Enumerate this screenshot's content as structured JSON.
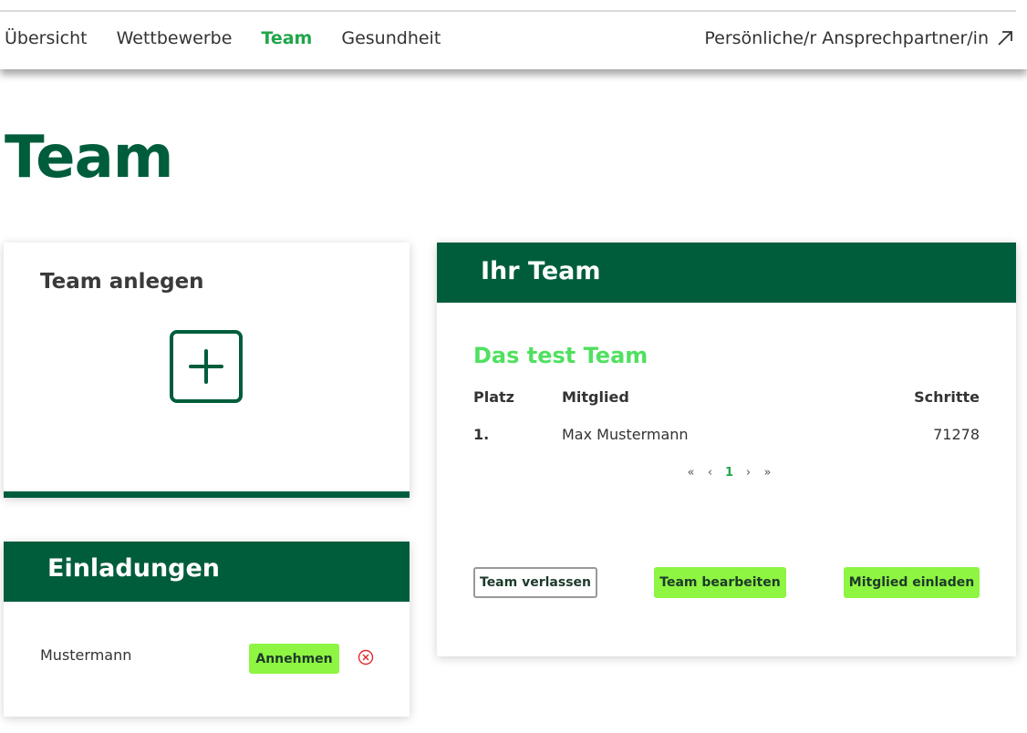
{
  "nav": {
    "items": [
      {
        "label": "Übersicht",
        "active": false
      },
      {
        "label": "Wettbewerbe",
        "active": false
      },
      {
        "label": "Team",
        "active": true
      },
      {
        "label": "Gesundheit",
        "active": false
      }
    ],
    "contact_label": "Persönliche/r Ansprechpartner/in",
    "contact_icon": "arrow-up-right-icon"
  },
  "page": {
    "title": "Team"
  },
  "create_team": {
    "title": "Team anlegen",
    "icon": "plus-square-icon"
  },
  "invitations": {
    "title": "Einladungen",
    "items": [
      {
        "name": "Mustermann",
        "accept_label": "Annehmen",
        "reject_icon": "close-circle-icon"
      }
    ]
  },
  "your_team": {
    "title": "Ihr Team",
    "team_name": "Das test Team",
    "columns": [
      "Platz",
      "Mitglied",
      "Schritte"
    ],
    "rows": [
      {
        "rank": "1.",
        "member": "Max Mustermann",
        "steps": "71278"
      }
    ],
    "pagination": {
      "first": "«",
      "prev": "‹",
      "current": "1",
      "next": "›",
      "last": "»"
    },
    "actions": {
      "leave_label": "Team verlassen",
      "edit_label": "Team bearbeiten",
      "invite_label": "Mitglied einladen"
    }
  },
  "colors": {
    "primary": "#005d3c",
    "accent_button": "#8ef542",
    "active_nav": "#1fa64a",
    "team_name": "#50e060",
    "reject_icon": "#e0282e"
  }
}
